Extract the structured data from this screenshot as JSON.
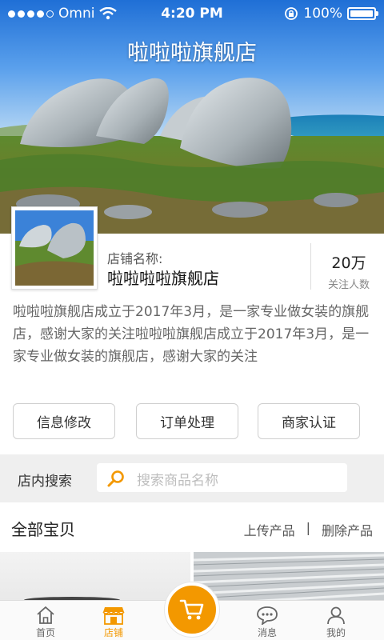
{
  "status_bar": {
    "carrier": "Omni",
    "time": "4:20 PM",
    "battery": "100%"
  },
  "banner": {
    "title": "啦啦啦旗舰店"
  },
  "shop": {
    "name_label": "店铺名称:",
    "name": "啦啦啦啦旗舰店",
    "followers_count": "20万",
    "followers_label": "关注人数",
    "description": "啦啦啦旗舰店成立于2017年3月，是一家专业做女装的旗舰店，感谢大家的关注啦啦啦旗舰店成立于2017年3月，是一家专业做女装的旗舰店，感谢大家的关注"
  },
  "actions": [
    {
      "label": "信息修改"
    },
    {
      "label": "订单处理"
    },
    {
      "label": "商家认证"
    }
  ],
  "search": {
    "label": "店内搜索",
    "placeholder": "搜索商品名称"
  },
  "items": {
    "title": "全部宝贝",
    "upload_label": "上传产品",
    "separator": "|",
    "delete_label": "删除产品"
  },
  "tabbar": {
    "tabs": [
      {
        "label": "首页",
        "icon": "home-icon"
      },
      {
        "label": "店铺",
        "icon": "shop-icon",
        "active": true
      },
      {
        "label": "",
        "icon": "cart-icon"
      },
      {
        "label": "消息",
        "icon": "message-icon"
      },
      {
        "label": "我的",
        "icon": "user-icon"
      }
    ]
  },
  "colors": {
    "accent": "#f39800",
    "text_primary": "#222222",
    "text_secondary": "#666666"
  }
}
